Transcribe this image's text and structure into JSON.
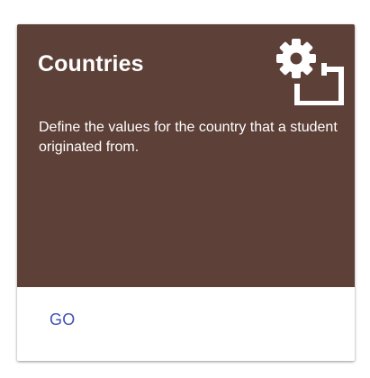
{
  "card": {
    "title": "Countries",
    "description": "Define the values for the country that a student originated from.",
    "icon": "settings-applications-icon",
    "header_color": "#5d4037",
    "action_label": "GO",
    "action_color": "#3f51b5"
  }
}
